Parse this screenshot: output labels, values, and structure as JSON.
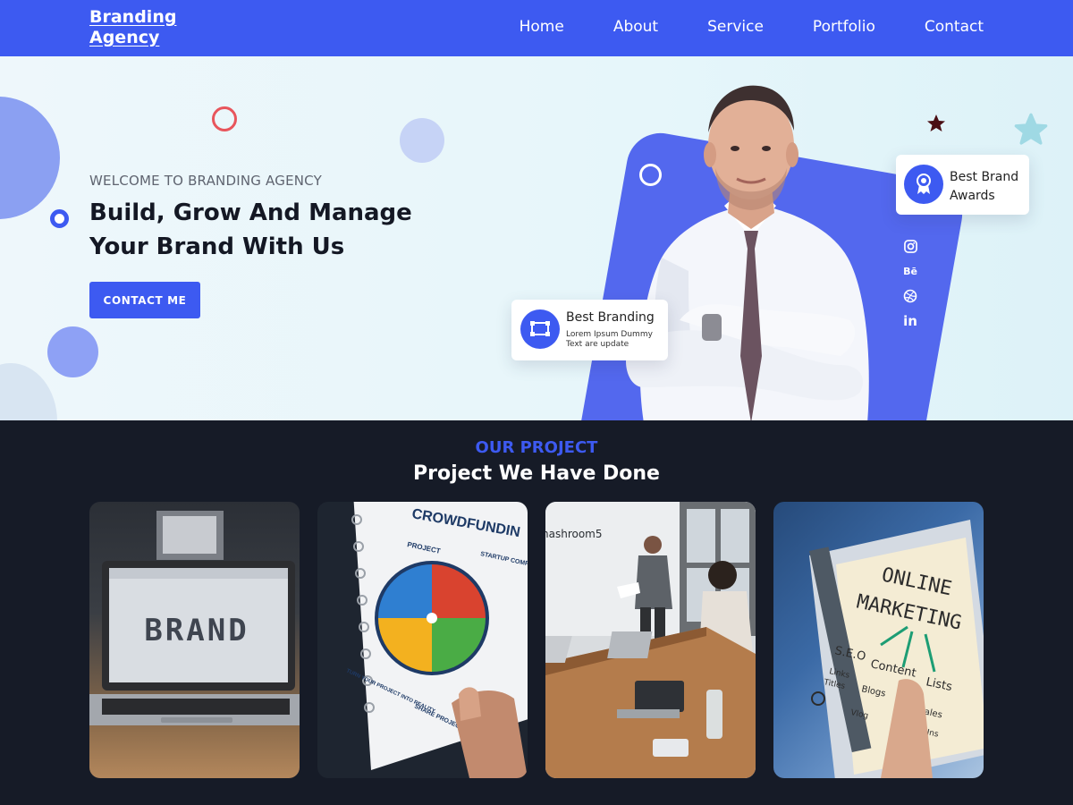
{
  "nav": {
    "logo_line1": "Branding",
    "logo_line2": "Agency",
    "items": [
      "Home",
      "About",
      "Service",
      "Portfolio",
      "Contact"
    ]
  },
  "hero": {
    "welcome": "WELCOME TO BRANDING AGENCY",
    "headline_line1": "Build, Grow And Manage",
    "headline_line2": "Your Brand With Us",
    "cta_label": "CONTACT ME",
    "card_branding": {
      "title": "Best Branding",
      "sub": "Lorem Ipsum Dummy Text are update",
      "icon": "design-icon"
    },
    "card_award": {
      "title_line1": "Best Brand",
      "title_line2": "Awards",
      "icon": "award-ribbon-icon"
    },
    "social": [
      "instagram-icon",
      "behance-icon",
      "dribbble-icon",
      "linkedin-icon"
    ],
    "behance_text": "Bē",
    "linkedin_text": "in"
  },
  "projects": {
    "kicker": "OUR PROJECT",
    "title": "Project We Have Done",
    "items": [
      {
        "image": "laptop-brand-photo",
        "text": "BRAND"
      },
      {
        "image": "crowdfunding-notebook-photo",
        "text": "CROWDFUNDIN",
        "labels": [
          "PROJECT",
          "STARTUP COMPANY",
          "TURN YOUR PROJECT INTO REALITY",
          "SHARE PROJECT"
        ]
      },
      {
        "image": "office-meeting-photo",
        "text": "nashroom5"
      },
      {
        "image": "online-marketing-tablet-photo",
        "text_line1": "ONLINE",
        "text_line2": "MARKETING",
        "labels": [
          "S.E.O",
          "Content",
          "Lists",
          "Links",
          "Titles",
          "Blogs",
          "Sales",
          "Opt-Ins",
          "Vlog"
        ]
      }
    ]
  },
  "colors": {
    "primary": "#3d5af1",
    "hero_bg": "#e6f6fa",
    "dark_bg": "#161b27",
    "accent_red": "#e8555c"
  }
}
